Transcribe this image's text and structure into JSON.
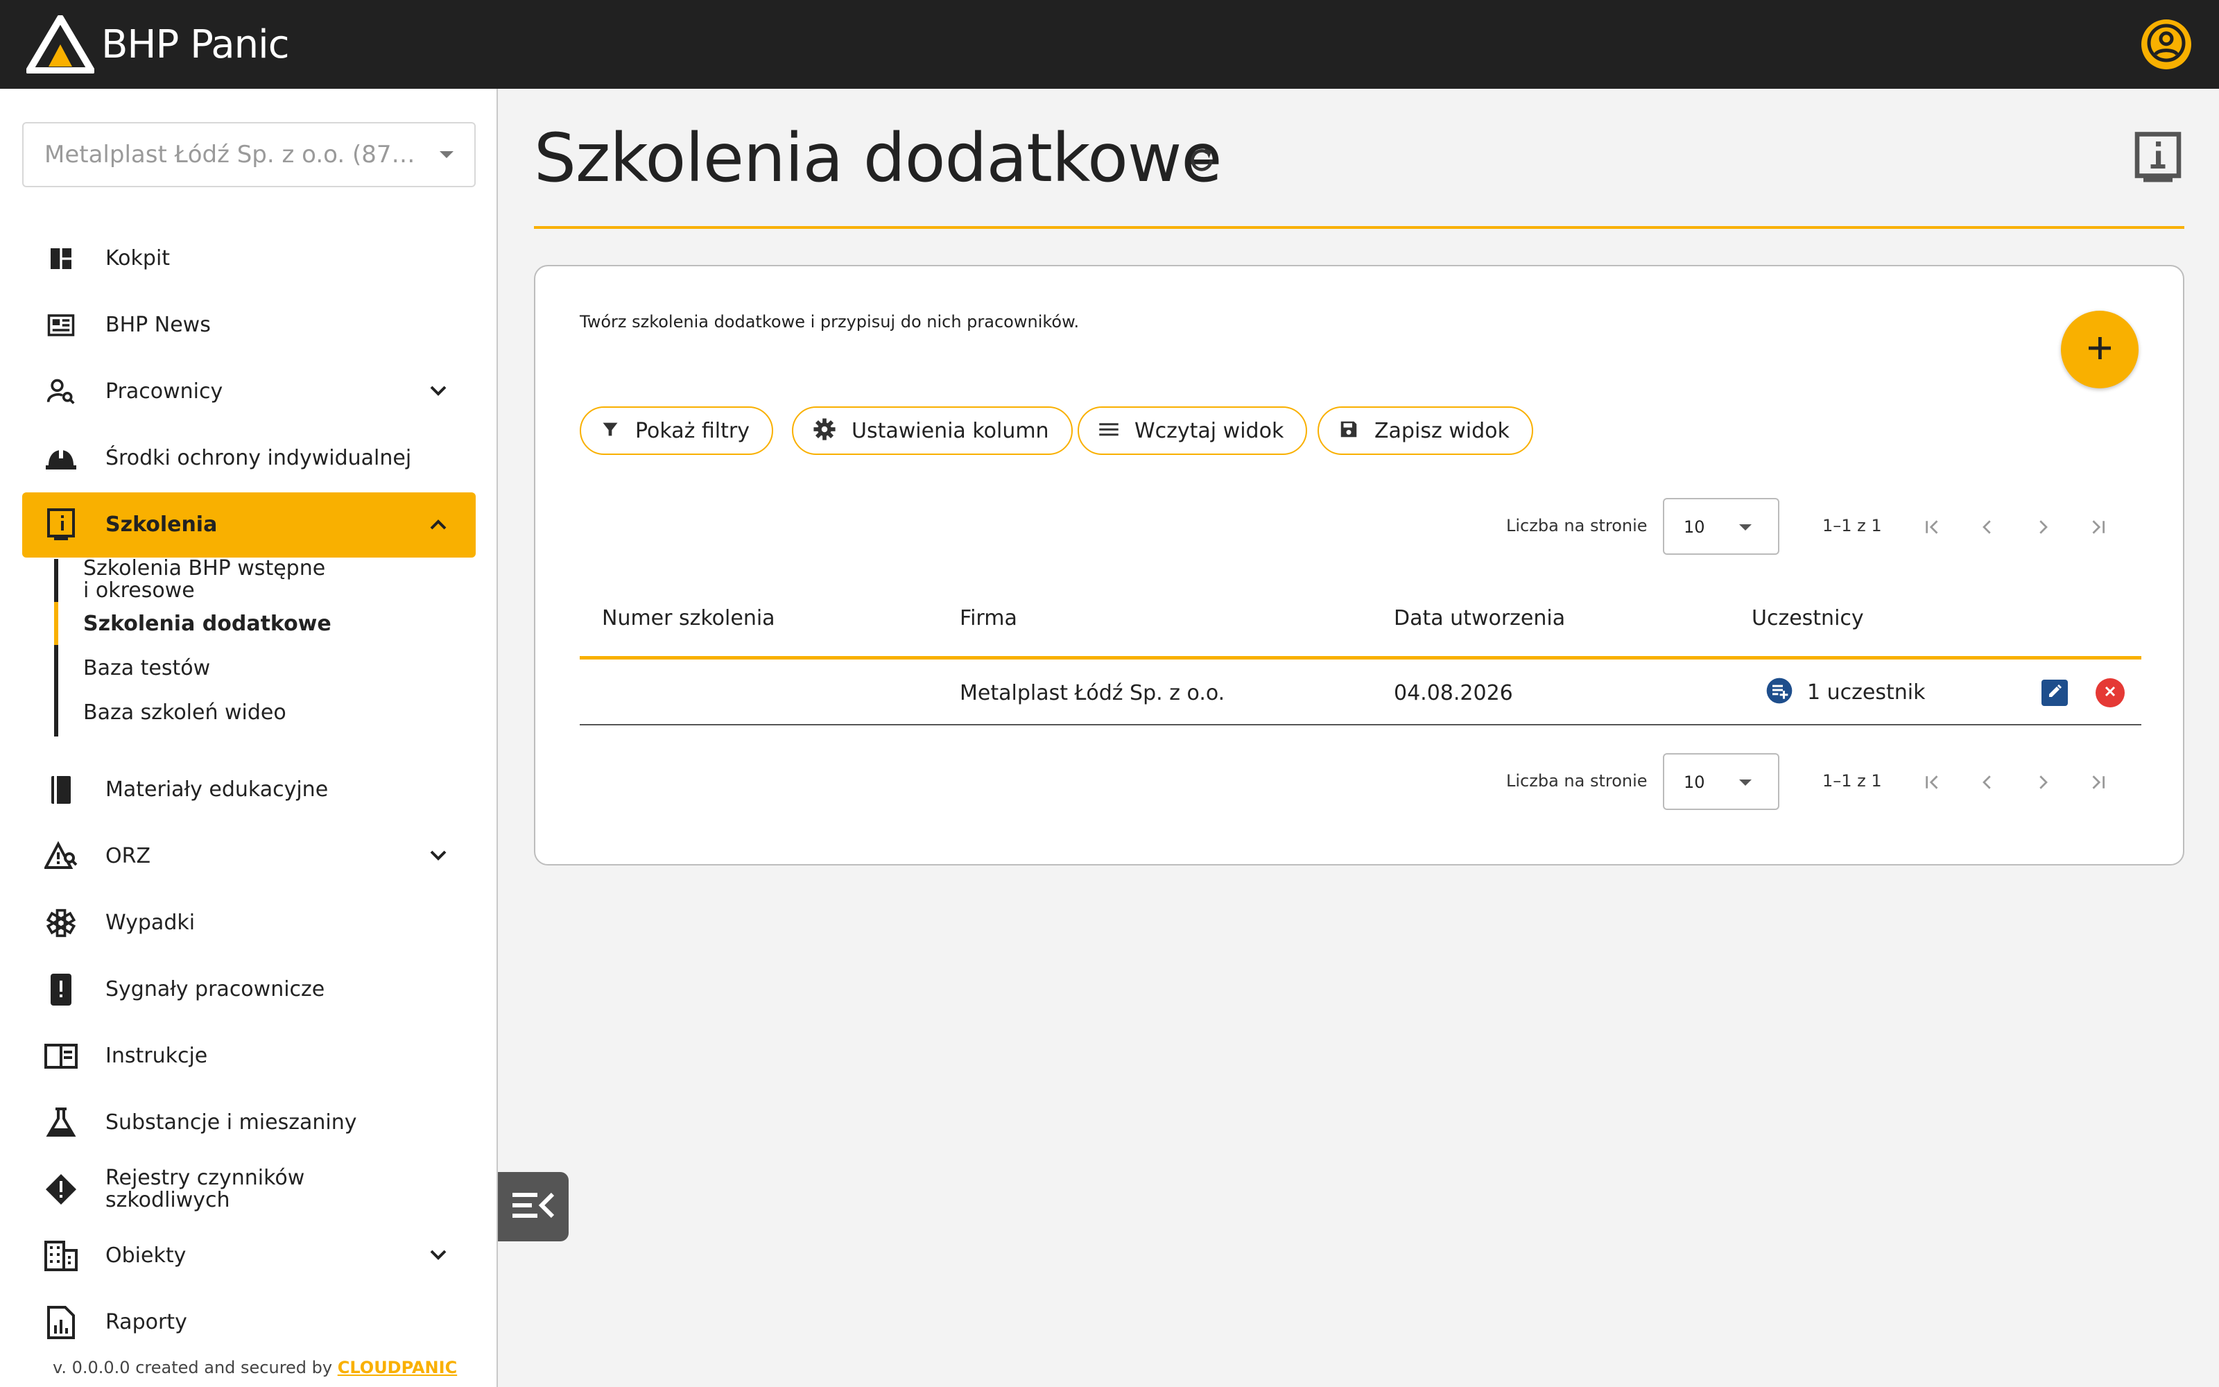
{
  "app": {
    "brand_name": "BHP Panic",
    "icons": {
      "logo": "triangle-logo-icon",
      "account": "account-circle-icon"
    },
    "colors": {
      "accent": "#f9b000",
      "topbar": "#212121",
      "edit": "#1e4e8c",
      "delete": "#e53935",
      "participants": "#1e4e8c"
    }
  },
  "sidebar": {
    "company_select": {
      "value": "Metalplast Łódź Sp. z o.o. (8721..."
    },
    "items": [
      {
        "label": "Kokpit",
        "icon": "dashboard-icon"
      },
      {
        "label": "BHP News",
        "icon": "newspaper-icon"
      },
      {
        "label": "Pracownicy",
        "icon": "person-search-icon",
        "expandable": true
      },
      {
        "label": "Środki ochrony indywidualnej",
        "icon": "hard-hat-icon"
      },
      {
        "label": "Szkolenia",
        "icon": "book-info-icon",
        "expandable": true,
        "active": true
      },
      {
        "label": "Materiały edukacyjne",
        "icon": "book-icon"
      },
      {
        "label": "ORZ",
        "icon": "risk-search-icon",
        "expandable": true
      },
      {
        "label": "Wypadki",
        "icon": "medical-asterisk-icon"
      },
      {
        "label": "Sygnały pracownicze",
        "icon": "phone-alert-icon"
      },
      {
        "label": "Instrukcje",
        "icon": "open-book-icon"
      },
      {
        "label": "Substancje i mieszaniny",
        "icon": "flask-icon"
      },
      {
        "label": "Rejestry czynników",
        "label2": "szkodliwych",
        "icon": "warning-diamond-icon"
      },
      {
        "label": "Obiekty",
        "icon": "building-icon",
        "expandable": true
      },
      {
        "label": "Raporty",
        "icon": "report-icon"
      }
    ],
    "sub_items": [
      {
        "label": "Szkolenia BHP wstępne",
        "label2": "i okresowe"
      },
      {
        "label": "Szkolenia dodatkowe",
        "active": true
      },
      {
        "label": "Baza testów"
      },
      {
        "label": "Baza szkoleń wideo"
      }
    ],
    "footer": {
      "prefix": "v. 0.0.0.0 created and secured by ",
      "brand": "CLOUDPANIC"
    }
  },
  "main": {
    "title": "Szkolenia dodatkowe",
    "description": "Twórz szkolenia dodatkowe i przypisuj do nich pracowników.",
    "toolbar": {
      "show_filters": "Pokaż filtry",
      "column_settings": "Ustawienia kolumn",
      "load_view": "Wczytaj widok",
      "save_view": "Zapisz widok"
    },
    "pagination": {
      "per_page_label": "Liczba na stronie",
      "per_page_value": "10",
      "range": "1–1 z 1"
    },
    "table": {
      "columns": [
        "Numer szkolenia",
        "Firma",
        "Data utworzenia",
        "Uczestnicy"
      ],
      "rows": [
        {
          "number": "",
          "company": "Metalplast Łódź Sp. z o.o.",
          "created": "04.08.2026",
          "participants": "1 uczestnik"
        }
      ]
    }
  }
}
